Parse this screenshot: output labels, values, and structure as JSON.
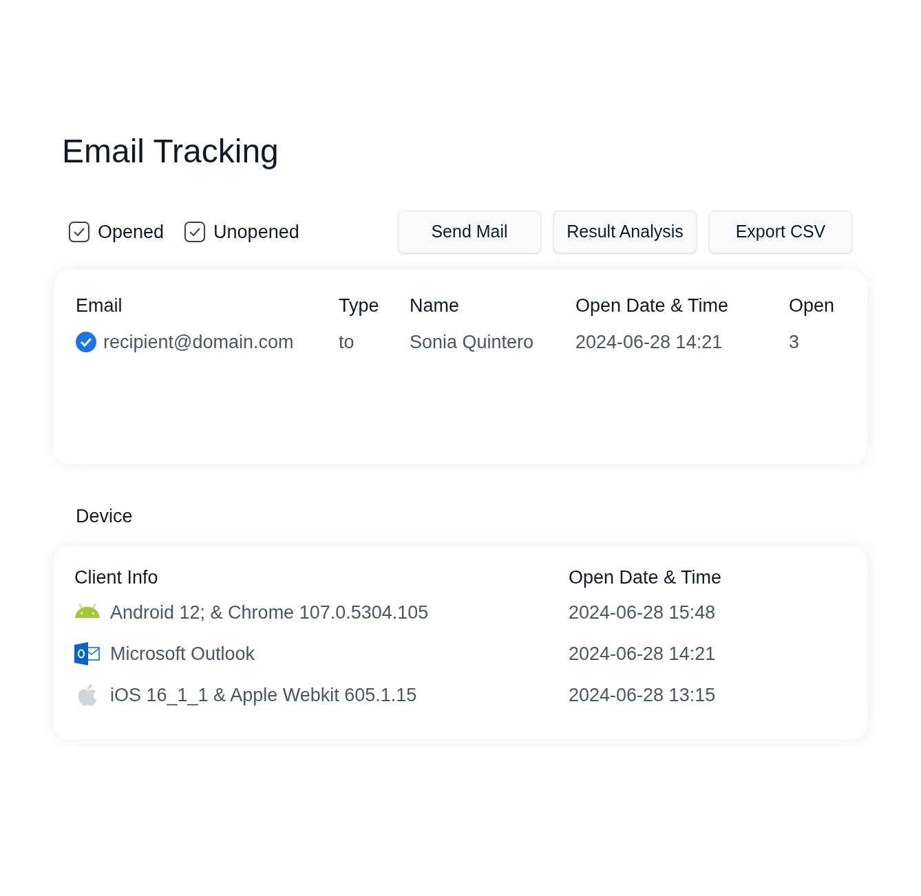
{
  "title": "Email Tracking",
  "filters": [
    {
      "label": "Opened",
      "checked": true
    },
    {
      "label": "Unopened",
      "checked": true
    }
  ],
  "buttons": [
    "Send Mail",
    "Result Analysis",
    "Export CSV"
  ],
  "table": {
    "columns": [
      "Email",
      "Type",
      "Name",
      "Open Date & Time",
      "Open"
    ],
    "rows": [
      {
        "verified": true,
        "cells": [
          "recipient@domain.com",
          "to",
          "Sonia Quintero",
          "2024-06-28 14:21",
          "3"
        ]
      }
    ]
  },
  "device": {
    "title": "Device",
    "columns": [
      "Client Info",
      "Open Date & Time"
    ],
    "rows": [
      {
        "kind": "android",
        "client": "Android 12; & Chrome 107.0.5304.105",
        "time": "2024-06-28 15:48"
      },
      {
        "kind": "outlook",
        "client": "Microsoft Outlook",
        "time": "2024-06-28 14:21"
      },
      {
        "kind": "apple",
        "client": "iOS 16_1_1 & Apple Webkit 605.1.15",
        "time": "2024-06-28 13:15"
      }
    ]
  }
}
